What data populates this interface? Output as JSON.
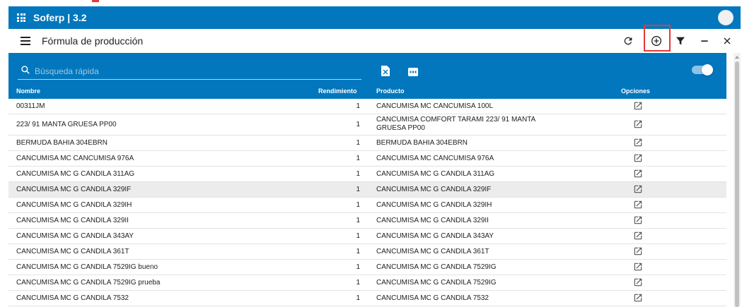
{
  "app": {
    "title": "Soferp | 3.2"
  },
  "page": {
    "title": "Fórmula de producción"
  },
  "search": {
    "placeholder": "Búsqueda rápida",
    "value": ""
  },
  "columns": {
    "nombre": "Nombre",
    "rendimiento": "Rendimiento",
    "producto": "Producto",
    "opciones": "Opciones"
  },
  "rows": [
    {
      "nombre": "00311JM",
      "rendimiento": "1",
      "producto": "CANCUMISA MC CANCUMISA 100L"
    },
    {
      "nombre": "223/ 91 MANTA GRUESA PP00",
      "rendimiento": "1",
      "producto": "CANCUMISA COMFORT TARAMI 223/ 91 MANTA GRUESA PP00",
      "tall": true
    },
    {
      "nombre": "BERMUDA BAHIA 304EBRN",
      "rendimiento": "1",
      "producto": "BERMUDA BAHIA 304EBRN"
    },
    {
      "nombre": "CANCUMISA MC CANCUMISA 976A",
      "rendimiento": "1",
      "producto": "CANCUMISA MC CANCUMISA 976A"
    },
    {
      "nombre": "CANCUMISA MC G CANDILA 311AG",
      "rendimiento": "1",
      "producto": "CANCUMISA MC G CANDILA 311AG"
    },
    {
      "nombre": "CANCUMISA MC G CANDILA 329IF",
      "rendimiento": "1",
      "producto": "CANCUMISA MC G CANDILA 329IF",
      "highlight": true
    },
    {
      "nombre": "CANCUMISA MC G CANDILA 329IH",
      "rendimiento": "1",
      "producto": "CANCUMISA MC G CANDILA 329IH"
    },
    {
      "nombre": "CANCUMISA MC G CANDILA 329II",
      "rendimiento": "1",
      "producto": "CANCUMISA MC G CANDILA 329II"
    },
    {
      "nombre": "CANCUMISA MC G CANDILA 343AY",
      "rendimiento": "1",
      "producto": "CANCUMISA MC G CANDILA 343AY"
    },
    {
      "nombre": "CANCUMISA MC G CANDILA 361T",
      "rendimiento": "1",
      "producto": "CANCUMISA MC G CANDILA 361T"
    },
    {
      "nombre": "CANCUMISA MC G CANDILA 7529IG bueno",
      "rendimiento": "1",
      "producto": "CANCUMISA MC G CANDILA 7529IG"
    },
    {
      "nombre": "CANCUMISA MC G CANDILA 7529IG prueba",
      "rendimiento": "1",
      "producto": "CANCUMISA MC G CANDILA 7529IG"
    },
    {
      "nombre": "CANCUMISA MC G CANDILA 7532",
      "rendimiento": "1",
      "producto": "CANCUMISA MC G CANDILA 7532"
    }
  ],
  "icons": {
    "apps": "apps-grid-icon",
    "avatar": "avatar",
    "menu": "hamburger-menu-icon",
    "refresh": "refresh-icon",
    "add": "add-circle-icon",
    "filter": "filter-icon",
    "minimize": "minimize-icon",
    "close": "close-icon",
    "search": "search-icon",
    "excel": "excel-export-icon",
    "pdf": "pdf-export-icon",
    "edit": "open-in-new-icon"
  },
  "colors": {
    "primary": "#0277bd",
    "highlight_box": "#e53935",
    "selected_row": "#ececec"
  },
  "view_toggle": {
    "on": true
  }
}
